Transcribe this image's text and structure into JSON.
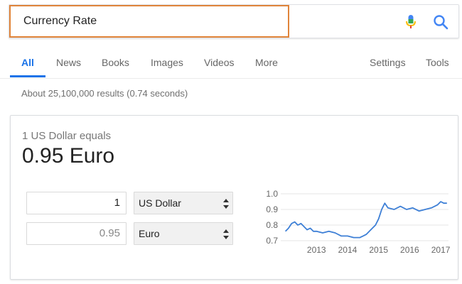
{
  "search": {
    "query": "Currency Rate"
  },
  "tabs": [
    {
      "label": "All"
    },
    {
      "label": "News"
    },
    {
      "label": "Books"
    },
    {
      "label": "Images"
    },
    {
      "label": "Videos"
    },
    {
      "label": "More"
    },
    {
      "label": "Settings"
    },
    {
      "label": "Tools"
    }
  ],
  "result_stats": "About 25,100,000 results (0.74 seconds)",
  "converter": {
    "equals_label": "1 US Dollar equals",
    "result": "0.95 Euro",
    "from_amount": "1",
    "from_currency": "US Dollar",
    "to_amount": "0.95",
    "to_currency": "Euro"
  },
  "colors": {
    "accent": "#1a73e8",
    "focus_border": "#e0843a",
    "line": "#3d7fd6"
  },
  "chart_data": {
    "type": "line",
    "x": [
      2012.0,
      2012.1,
      2012.2,
      2012.3,
      2012.4,
      2012.5,
      2012.6,
      2012.7,
      2012.8,
      2012.9,
      2013.0,
      2013.2,
      2013.4,
      2013.6,
      2013.8,
      2014.0,
      2014.2,
      2014.4,
      2014.5,
      2014.6,
      2014.7,
      2014.8,
      2014.9,
      2015.0,
      2015.1,
      2015.2,
      2015.3,
      2015.5,
      2015.7,
      2015.9,
      2016.1,
      2016.3,
      2016.5,
      2016.7,
      2016.9,
      2017.0,
      2017.1,
      2017.2
    ],
    "series": [
      {
        "values": [
          0.76,
          0.78,
          0.81,
          0.82,
          0.8,
          0.81,
          0.79,
          0.77,
          0.78,
          0.76,
          0.76,
          0.75,
          0.76,
          0.75,
          0.73,
          0.73,
          0.72,
          0.72,
          0.73,
          0.74,
          0.76,
          0.78,
          0.8,
          0.84,
          0.9,
          0.94,
          0.91,
          0.9,
          0.92,
          0.9,
          0.91,
          0.89,
          0.9,
          0.91,
          0.93,
          0.95,
          0.94,
          0.94
        ]
      }
    ],
    "x_ticks": [
      "2013",
      "2014",
      "2015",
      "2016",
      "2017"
    ],
    "x_tick_values": [
      2013,
      2014,
      2015,
      2016,
      2017
    ],
    "y_ticks": [
      "1.0",
      "0.9",
      "0.8",
      "0.7"
    ],
    "y_tick_values": [
      1.0,
      0.9,
      0.8,
      0.7
    ],
    "xlim": [
      2011.85,
      2017.25
    ],
    "ylim": [
      0.7,
      1.0
    ],
    "grid": true
  }
}
